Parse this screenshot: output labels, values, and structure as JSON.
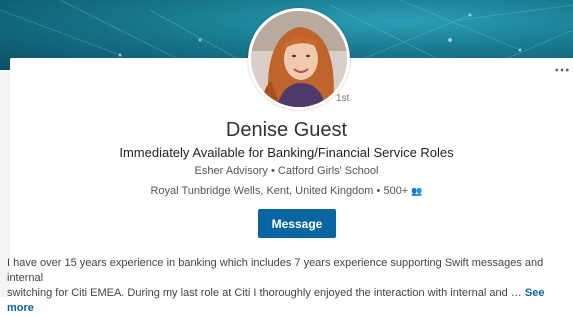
{
  "profile": {
    "name": "Denise Guest",
    "degree": "1st",
    "headline": "Immediately Available for Banking/Financial Service Roles",
    "company": "Esher Advisory",
    "school": "Catford Girls' School",
    "separator": "•",
    "location": "Royal Tunbridge Wells, Kent, United Kingdom",
    "connections": "500+",
    "connections_icon": "people-icon",
    "summary_line1": "I have over 15 years experience in banking which includes 7 years experience supporting Swift messages and internal",
    "summary_line2": "switching for Citi EMEA. During my last role at Citi I thoroughly enjoyed the interaction with internal and …",
    "see_more": "See more"
  },
  "actions": {
    "message_label": "Message",
    "more_label": "⋯",
    "more_icon": "more-dots-icon"
  },
  "colors": {
    "banner": "#17778d",
    "accent": "#0a66a0"
  }
}
